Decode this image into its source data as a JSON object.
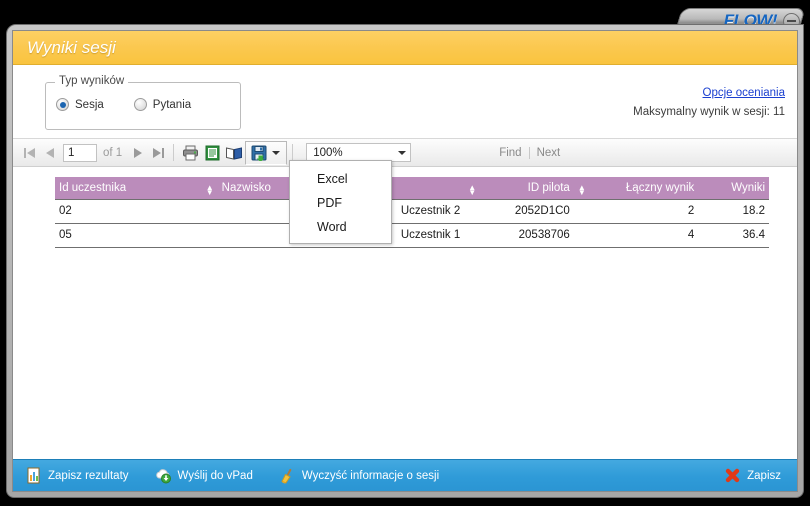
{
  "window": {
    "brand": "FLOW!",
    "minimize_icon": "minimize-icon",
    "title": "Wyniki sesji"
  },
  "form": {
    "fieldset_legend": "Typ wyników",
    "radios": [
      {
        "label": "Sesja",
        "checked": true
      },
      {
        "label": "Pytania",
        "checked": false
      }
    ],
    "grading_link": "Opcje oceniania",
    "max_score_text": "Maksymalny wynik w sesji: 11"
  },
  "report_toolbar": {
    "first_icon": "first-page-icon",
    "prev_icon": "previous-page-icon",
    "page_value": "1",
    "of_label": "of 1",
    "next_icon": "next-page-icon",
    "last_icon": "last-page-icon",
    "print_icon": "print-icon",
    "page_setup_icon": "page-setup-icon",
    "print_layout_icon": "print-layout-icon",
    "export_icon": "export-save-icon",
    "export_caret_icon": "chevron-down-icon",
    "zoom_value": "100%",
    "zoom_caret_icon": "chevron-down-icon",
    "find_label": "Find",
    "next_label": "Next"
  },
  "export_menu": {
    "items": [
      {
        "label": "Excel"
      },
      {
        "label": "PDF"
      },
      {
        "label": "Word"
      }
    ]
  },
  "table": {
    "columns": [
      {
        "label": "Id uczestnika",
        "sortable": true
      },
      {
        "label": "Nazwisko",
        "sortable": true
      },
      {
        "label": "ID pilota",
        "sortable": true
      },
      {
        "label": "Łączny wynik",
        "sortable": false
      },
      {
        "label": "Wyniki",
        "sortable": false
      }
    ],
    "rows": [
      {
        "id_uczestnika": "02",
        "nazwisko": "Uczestnik 2",
        "id_pilota": "2052D1C0",
        "laczny_wynik": "2",
        "wyniki": "18.2"
      },
      {
        "id_uczestnika": "05",
        "nazwisko": "Uczestnik 1",
        "id_pilota": "20538706",
        "laczny_wynik": "4",
        "wyniki": "36.4"
      }
    ]
  },
  "bottom_bar": {
    "save_results": "Zapisz rezultaty",
    "send_to_vpad": "Wyślij do vPad",
    "clear_session": "Wyczyść informacje o sesji",
    "save": "Zapisz",
    "icons": {
      "save_results": "chart-document-icon",
      "send_to_vpad": "cloud-download-icon",
      "clear_session": "broom-icon",
      "save": "red-x-icon"
    }
  },
  "colors": {
    "title_bar": "#f9c43f",
    "table_header": "#bb8cbb",
    "bottom_bar": "#2f9bd8",
    "brand": "#1565c0",
    "link": "#1a3fd0"
  }
}
